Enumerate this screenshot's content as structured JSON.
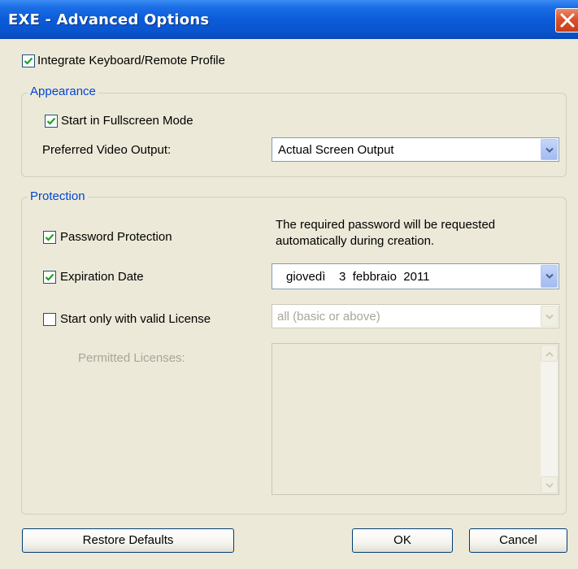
{
  "window": {
    "title": "EXE - Advanced Options"
  },
  "general": {
    "integrate_profile_label": "Integrate Keyboard/Remote Profile",
    "integrate_profile_checked": true
  },
  "appearance": {
    "group_label": "Appearance",
    "fullscreen_label": "Start in Fullscreen Mode",
    "fullscreen_checked": true,
    "video_output_label": "Preferred Video Output:",
    "video_output_value": "Actual Screen Output"
  },
  "protection": {
    "group_label": "Protection",
    "password_label": "Password Protection",
    "password_checked": true,
    "password_note_line1": "The required password will be requested",
    "password_note_line2": "automatically during creation.",
    "expiration_label": "Expiration Date",
    "expiration_checked": true,
    "expiration_value": "giovedì    3  febbraio  2011",
    "license_label": "Start only with valid License",
    "license_checked": false,
    "license_value": "all (basic or above)",
    "permitted_licenses_label": "Permitted Licenses:"
  },
  "buttons": {
    "restore_defaults": "Restore Defaults",
    "ok": "OK",
    "cancel": "Cancel"
  },
  "colors": {
    "titlebar": "#0b5bd8",
    "group_label": "#0046d5",
    "checkmark": "#21a121",
    "disabled_text": "#a7a69b"
  }
}
